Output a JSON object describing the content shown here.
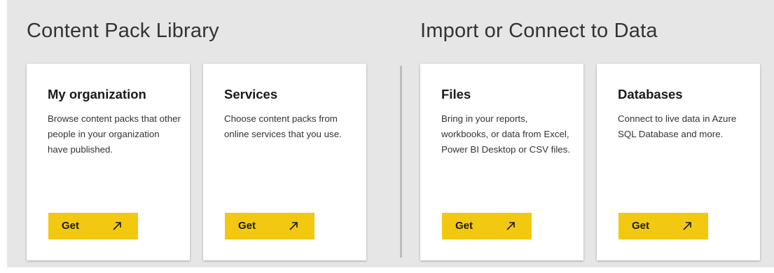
{
  "sections": {
    "content_pack_library": {
      "title": "Content Pack Library"
    },
    "import_connect": {
      "title": "Import or Connect to Data"
    }
  },
  "cards": [
    {
      "title": "My organization",
      "description": "Browse content packs that other people in your organization have published.",
      "button_label": "Get",
      "button_icon": "arrow-up-right-icon"
    },
    {
      "title": "Services",
      "description": "Choose content packs from online services that you use.",
      "button_label": "Get",
      "button_icon": "arrow-up-right-icon"
    },
    {
      "title": "Files",
      "description": "Bring in your reports, workbooks, or data from Excel, Power BI Desktop or CSV files.",
      "button_label": "Get",
      "button_icon": "arrow-up-right-icon"
    },
    {
      "title": "Databases",
      "description": "Connect to live data in Azure SQL Database and more.",
      "button_label": "Get",
      "button_icon": "arrow-up-right-icon"
    }
  ],
  "colors": {
    "button": "#f2c811",
    "background": "#e6e6e6",
    "card": "#ffffff"
  }
}
